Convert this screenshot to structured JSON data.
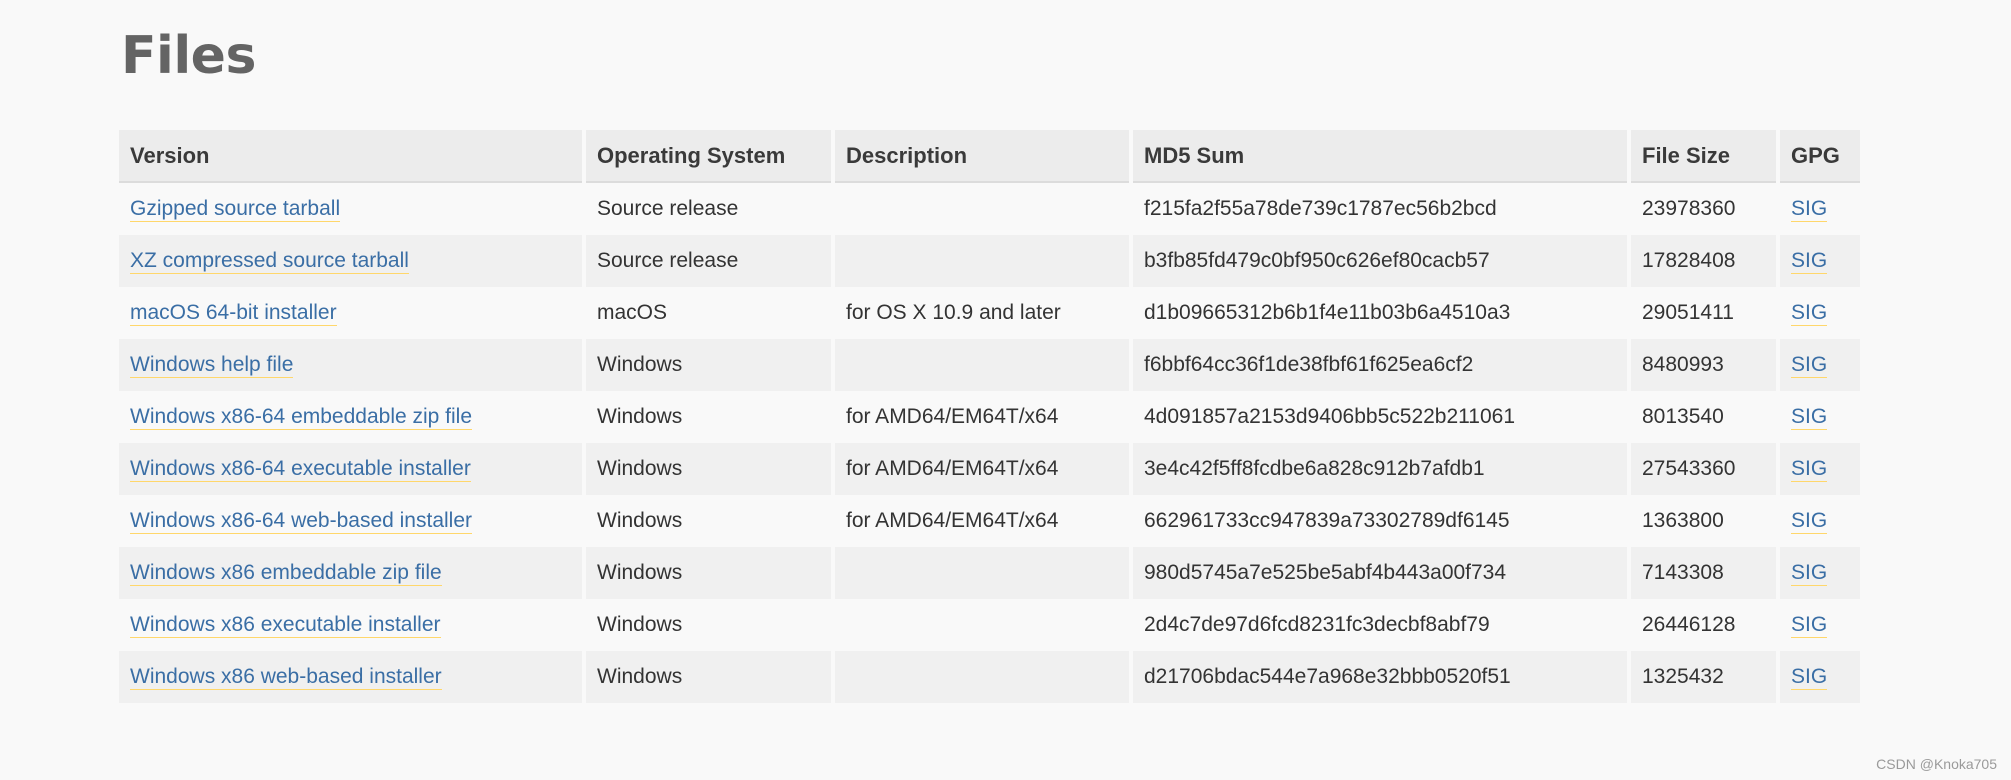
{
  "page": {
    "title": "Files",
    "watermark": "CSDN @Knoka705"
  },
  "table": {
    "headers": {
      "version": "Version",
      "os": "Operating System",
      "description": "Description",
      "md5": "MD5 Sum",
      "size": "File Size",
      "gpg": "GPG"
    },
    "rows": [
      {
        "version": "Gzipped source tarball",
        "os": "Source release",
        "description": "",
        "md5": "f215fa2f55a78de739c1787ec56b2bcd",
        "size": "23978360",
        "gpg": "SIG"
      },
      {
        "version": "XZ compressed source tarball",
        "os": "Source release",
        "description": "",
        "md5": "b3fb85fd479c0bf950c626ef80cacb57",
        "size": "17828408",
        "gpg": "SIG"
      },
      {
        "version": "macOS 64-bit installer",
        "os": "macOS",
        "description": "for OS X 10.9 and later",
        "md5": "d1b09665312b6b1f4e11b03b6a4510a3",
        "size": "29051411",
        "gpg": "SIG"
      },
      {
        "version": "Windows help file",
        "os": "Windows",
        "description": "",
        "md5": "f6bbf64cc36f1de38fbf61f625ea6cf2",
        "size": "8480993",
        "gpg": "SIG"
      },
      {
        "version": "Windows x86-64 embeddable zip file",
        "os": "Windows",
        "description": "for AMD64/EM64T/x64",
        "md5": "4d091857a2153d9406bb5c522b211061",
        "size": "8013540",
        "gpg": "SIG"
      },
      {
        "version": "Windows x86-64 executable installer",
        "os": "Windows",
        "description": "for AMD64/EM64T/x64",
        "md5": "3e4c42f5ff8fcdbe6a828c912b7afdb1",
        "size": "27543360",
        "gpg": "SIG"
      },
      {
        "version": "Windows x86-64 web-based installer",
        "os": "Windows",
        "description": "for AMD64/EM64T/x64",
        "md5": "662961733cc947839a73302789df6145",
        "size": "1363800",
        "gpg": "SIG"
      },
      {
        "version": "Windows x86 embeddable zip file",
        "os": "Windows",
        "description": "",
        "md5": "980d5745a7e525be5abf4b443a00f734",
        "size": "7143308",
        "gpg": "SIG"
      },
      {
        "version": "Windows x86 executable installer",
        "os": "Windows",
        "description": "",
        "md5": "2d4c7de97d6fcd8231fc3decbf8abf79",
        "size": "26446128",
        "gpg": "SIG"
      },
      {
        "version": "Windows x86 web-based installer",
        "os": "Windows",
        "description": "",
        "md5": "d21706bdac544e7a968e32bbb0520f51",
        "size": "1325432",
        "gpg": "SIG"
      }
    ]
  },
  "colors": {
    "link": "#3a6ea5",
    "link_underline": "#ffd76b",
    "header_bg": "#ececec",
    "row_alt_bg": "#f0f0f0",
    "title": "#646464"
  }
}
